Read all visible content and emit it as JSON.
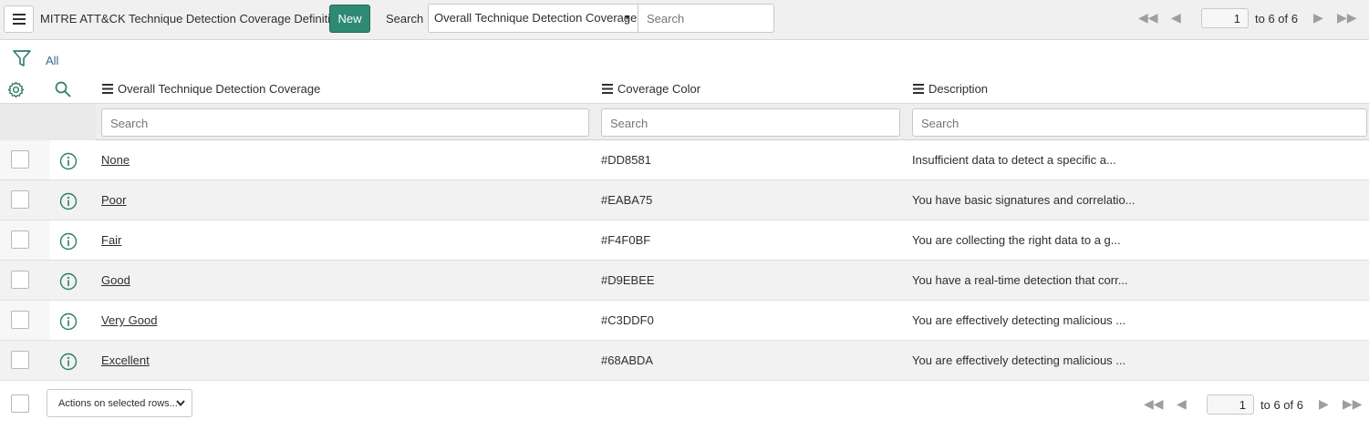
{
  "toolbar": {
    "title": "MITRE ATT&CK Technique Detection Coverage Definitions",
    "new_label": "New",
    "search_label": "Search",
    "search_field_selected": "Overall Technique Detection Coverage",
    "search_placeholder": "Search"
  },
  "pager_top": {
    "page": "1",
    "range_text": "to 6 of 6"
  },
  "filter": {
    "label": "All"
  },
  "columns": [
    {
      "label": "Overall Technique Detection Coverage",
      "search_placeholder": "Search"
    },
    {
      "label": "Coverage Color",
      "search_placeholder": "Search"
    },
    {
      "label": "Description",
      "search_placeholder": "Search"
    }
  ],
  "rows": [
    {
      "name": "None",
      "color": "#DD8581",
      "description": "Insufficient data to detect a specific a..."
    },
    {
      "name": "Poor",
      "color": "#EABA75",
      "description": "You have basic signatures and correlatio..."
    },
    {
      "name": "Fair",
      "color": "#F4F0BF",
      "description": "You are collecting the right data to a g..."
    },
    {
      "name": "Good",
      "color": "#D9EBEE",
      "description": "You have a real-time detection that corr..."
    },
    {
      "name": "Very Good",
      "color": "#C3DDF0",
      "description": "You are effectively detecting malicious ..."
    },
    {
      "name": "Excellent",
      "color": "#68ABDA",
      "description": "You are effectively detecting malicious ..."
    }
  ],
  "footer": {
    "actions_label": "Actions on selected rows..."
  },
  "pager_bottom": {
    "page": "1",
    "range_text": "to 6 of 6"
  },
  "theme": {
    "accent": "#2e8a73",
    "icon_color": "#2e7d6b",
    "link_blue": "#2e6d8f"
  }
}
